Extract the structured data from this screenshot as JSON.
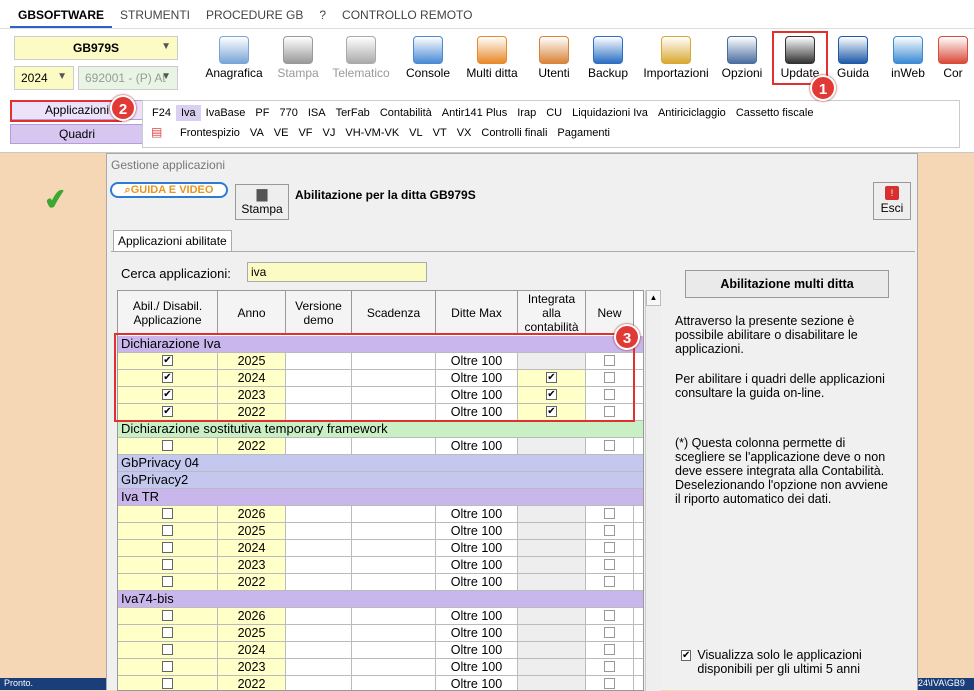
{
  "menu": [
    "GBSOFTWARE",
    "STRUMENTI",
    "PROCEDURE GB",
    "?",
    "CONTROLLO REMOTO"
  ],
  "firm": {
    "code": "GB979S",
    "year": "2024",
    "account": "692001 - (P) At"
  },
  "toolbar": [
    {
      "label": "Anagrafica",
      "icon": "person-card-icon",
      "color": "#7aa5d8"
    },
    {
      "label": "Stampa",
      "icon": "printer-icon",
      "color": "#999",
      "disabled": true
    },
    {
      "label": "Telematico",
      "icon": "telematic-icon",
      "color": "#aaa",
      "disabled": true
    },
    {
      "label": "Console",
      "icon": "console-icon",
      "color": "#4a8ad4"
    },
    {
      "label": "Multi ditta",
      "icon": "network-icon",
      "color": "#e88a2a"
    },
    {
      "label": "Utenti",
      "icon": "users-icon",
      "color": "#d9843a"
    },
    {
      "label": "Backup",
      "icon": "backup-icon",
      "color": "#2c6fc4"
    },
    {
      "label": "Importazioni",
      "icon": "import-icon",
      "color": "#d9a833"
    },
    {
      "label": "Opzioni",
      "icon": "gear-icon",
      "color": "#4a6ea0"
    },
    {
      "label": "Update",
      "icon": "monitor-icon",
      "color": "#333"
    },
    {
      "label": "Guida",
      "icon": "help-icon",
      "color": "#1e5aa8"
    },
    {
      "label": "inWeb",
      "icon": "cloud-icon",
      "color": "#3a8ad4"
    },
    {
      "label": "Cor",
      "icon": "connect-icon",
      "color": "#d94a3a"
    }
  ],
  "left_buttons": [
    "Applicazioni",
    "Quadri"
  ],
  "quadri_row1": [
    "F24",
    "Iva",
    "IvaBase",
    "PF",
    "770",
    "ISA",
    "TerFab",
    "Contabilità",
    "Antir141 Plus",
    "Irap",
    "CU",
    "Liquidazioni Iva",
    "Antiriciclaggio",
    "Cassetto fiscale"
  ],
  "quadri_row2": [
    "Frontespizio",
    "VA",
    "VE",
    "VF",
    "VJ",
    "VH-VM-VK",
    "VL",
    "VT",
    "VX",
    "Controlli finali",
    "Pagamenti"
  ],
  "panel": {
    "title": "Gestione applicazioni",
    "guida": "GUIDA E VIDEO",
    "stampa": "Stampa",
    "heading": "Abilitazione per la ditta GB979S",
    "esci": "Esci",
    "tab": "Applicazioni abilitate",
    "search_label": "Cerca applicazioni:",
    "search_value": "iva",
    "multi": "Abilitazione multi ditta",
    "info1": "Attraverso la presente sezione è possibile abilitare o disabilitare le applicazioni.",
    "info2": "Per abilitare i quadri delle applicazioni consultare la guida on-line.",
    "info3": "(*) Questa colonna permette di scegliere se l'applicazione deve o non deve essere integrata alla Contabilità. Deselezionando l'opzione non avviene il riporto automatico dei dati.",
    "show5": "Visualizza solo le applicazioni disponibili per gli ultimi 5 anni"
  },
  "table": {
    "headers": [
      "Abil./ Disabil. Applicazione",
      "Anno",
      "Versione demo",
      "Scadenza",
      "Ditte Max",
      "Integrata alla contabilità",
      "New"
    ],
    "rows": [
      {
        "group": "Dichiarazione Iva",
        "color": "#c8b6ec"
      },
      {
        "check": true,
        "year": "2025",
        "max": "Oltre 100",
        "integ": null,
        "newcb": true
      },
      {
        "check": true,
        "year": "2024",
        "max": "Oltre 100",
        "integ": true,
        "newcb": true
      },
      {
        "check": true,
        "year": "2023",
        "max": "Oltre 100",
        "integ": true,
        "newcb": true
      },
      {
        "check": true,
        "year": "2022",
        "max": "Oltre 100",
        "integ": true,
        "newcb": true
      },
      {
        "group": "Dichiarazione sostitutiva temporary framework",
        "color": "#c9f0c4"
      },
      {
        "check": false,
        "year": "2022",
        "max": "Oltre 100",
        "integ": null,
        "newcb": false
      },
      {
        "group": "GbPrivacy 04",
        "color": "#c4c8ee"
      },
      {
        "group": "GbPrivacy2",
        "color": "#c4c8ee"
      },
      {
        "group": "Iva TR",
        "color": "#c8b6ec"
      },
      {
        "check": false,
        "year": "2026",
        "max": "Oltre 100",
        "integ": null,
        "newcb": true
      },
      {
        "check": false,
        "year": "2025",
        "max": "Oltre 100",
        "integ": null,
        "newcb": true
      },
      {
        "check": false,
        "year": "2024",
        "max": "Oltre 100",
        "integ": null,
        "newcb": true
      },
      {
        "check": false,
        "year": "2023",
        "max": "Oltre 100",
        "integ": null,
        "newcb": true
      },
      {
        "check": false,
        "year": "2022",
        "max": "Oltre 100",
        "integ": null,
        "newcb": true
      },
      {
        "group": "Iva74-bis",
        "color": "#c8b6ec"
      },
      {
        "check": false,
        "year": "2026",
        "max": "Oltre 100",
        "integ": null,
        "newcb": true
      },
      {
        "check": false,
        "year": "2025",
        "max": "Oltre 100",
        "integ": null,
        "newcb": true
      },
      {
        "check": false,
        "year": "2024",
        "max": "Oltre 100",
        "integ": null,
        "newcb": true
      },
      {
        "check": false,
        "year": "2023",
        "max": "Oltre 100",
        "integ": null,
        "newcb": true
      },
      {
        "check": false,
        "year": "2022",
        "max": "Oltre 100",
        "integ": null,
        "newcb": true
      }
    ]
  },
  "badges": [
    "1",
    "2",
    "3"
  ],
  "status": {
    "left": "Pronto.",
    "right": "24\\IVA\\GB9"
  }
}
